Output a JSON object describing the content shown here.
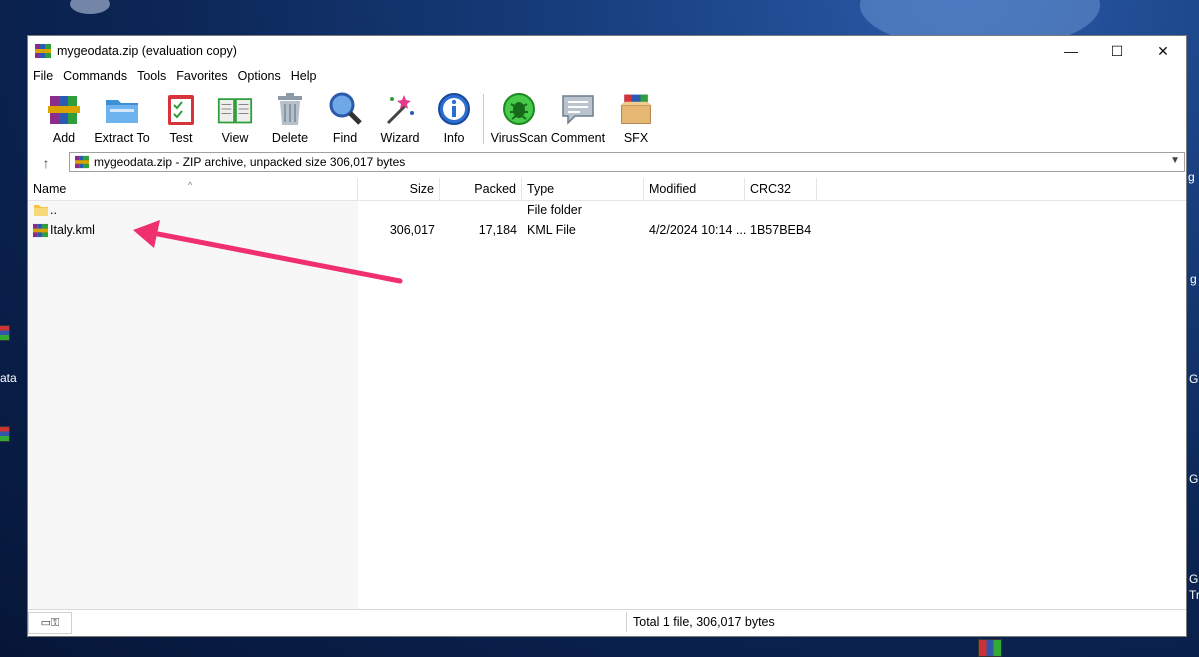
{
  "window": {
    "title": "mygeodata.zip (evaluation copy)",
    "controls": {
      "minimize": "—",
      "maximize": "☐",
      "close": "✕"
    }
  },
  "menu": [
    "File",
    "Commands",
    "Tools",
    "Favorites",
    "Options",
    "Help"
  ],
  "toolbar": [
    {
      "label": "Add",
      "icon": "add-archive-icon"
    },
    {
      "label": "Extract To",
      "icon": "extract-folder-icon"
    },
    {
      "label": "Test",
      "icon": "test-clipboard-icon"
    },
    {
      "label": "View",
      "icon": "view-book-icon"
    },
    {
      "label": "Delete",
      "icon": "trash-icon"
    },
    {
      "label": "Find",
      "icon": "magnifier-icon"
    },
    {
      "label": "Wizard",
      "icon": "magic-wand-icon"
    },
    {
      "label": "Info",
      "icon": "info-icon"
    },
    {
      "label": "VirusScan",
      "icon": "virus-scan-icon"
    },
    {
      "label": "Comment",
      "icon": "comment-icon"
    },
    {
      "label": "SFX",
      "icon": "sfx-box-icon"
    }
  ],
  "address": {
    "path": "mygeodata.zip - ZIP archive, unpacked size 306,017 bytes"
  },
  "columns": [
    "Name",
    "Size",
    "Packed",
    "Type",
    "Modified",
    "CRC32"
  ],
  "rows": [
    {
      "name": "..",
      "size": "",
      "packed": "",
      "type": "File folder",
      "modified": "",
      "crc": ""
    },
    {
      "name": "Italy.kml",
      "size": "306,017",
      "packed": "17,184",
      "type": "KML File",
      "modified": "4/2/2024 10:14 ...",
      "crc": "1B57BEB4"
    }
  ],
  "status": {
    "summary": "Total 1 file, 306,017 bytes"
  },
  "desktop": {
    "left_labels": [
      "ata"
    ],
    "right_labels": [
      "g",
      "g",
      "G",
      "G",
      "G",
      "Tr"
    ]
  },
  "colors": {
    "annotation_arrow": "#f0306e",
    "folder": "#f4c542"
  }
}
